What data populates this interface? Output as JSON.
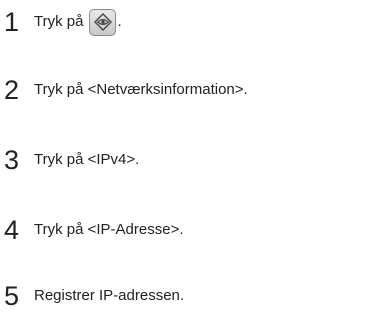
{
  "steps": [
    {
      "number": "1",
      "text": "Tryk på",
      "suffix": ".",
      "icon": "home-key-icon"
    },
    {
      "number": "2",
      "text": "Tryk på <Netværksinformation>."
    },
    {
      "number": "3",
      "text": "Tryk på <IPv4>."
    },
    {
      "number": "4",
      "text": "Tryk på <IP-Adresse>."
    },
    {
      "number": "5",
      "text": "Registrer IP-adressen."
    }
  ]
}
